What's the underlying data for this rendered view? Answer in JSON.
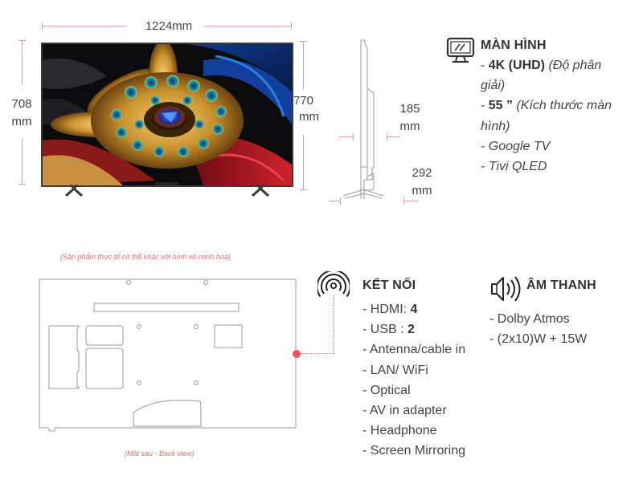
{
  "dimensions": {
    "width": "1224mm",
    "height_panel": {
      "value": "708",
      "unit": "mm"
    },
    "height_total": {
      "value": "770",
      "unit": "mm"
    },
    "depth_panel": {
      "value": "185",
      "unit": "mm"
    },
    "depth_stand": {
      "value": "292",
      "unit": "mm"
    }
  },
  "screen": {
    "icon": "monitor-icon",
    "title": "MÀN HÌNH",
    "lines": [
      {
        "prefix": "- ",
        "bold": "4K (UHD)",
        "italic": " (Độ phân"
      },
      {
        "prefix": "",
        "bold": "",
        "italic": "giải)"
      },
      {
        "prefix": "- ",
        "bold": "55 ”",
        "italic": " (Kích thước màn"
      },
      {
        "prefix": "",
        "bold": "",
        "italic": "hình)"
      },
      {
        "prefix": "",
        "bold": "",
        "italic": "- Google TV"
      },
      {
        "prefix": "",
        "bold": "",
        "italic": "- Tivi QLED"
      }
    ]
  },
  "notes": {
    "disclaimer": "(Sản phẩm thực tế có thể khác với hình vẽ minh hoạ)",
    "back_view": "(Mặt sau - Back view)"
  },
  "connectivity": {
    "icon": "signal-broadcast-icon",
    "title": "KẾT NỐI",
    "items": [
      {
        "text": "- HDMI: ",
        "bold": "4"
      },
      {
        "text": "- USB : ",
        "bold": "2"
      },
      {
        "text": "- Antenna/cable in",
        "bold": ""
      },
      {
        "text": "- LAN/ WiFi",
        "bold": ""
      },
      {
        "text": "- Optical",
        "bold": ""
      },
      {
        "text": "- AV in adapter",
        "bold": ""
      },
      {
        "text": "- Headphone",
        "bold": ""
      },
      {
        "text": "- Screen Mirroring",
        "bold": ""
      }
    ]
  },
  "audio": {
    "icon": "speaker-icon",
    "title": "ÂM THANH",
    "items": [
      "- Dolby Atmos",
      "- (2x10)W + 15W"
    ]
  },
  "colors": {
    "dimension_line": "#d9a0a6",
    "accent_red": "#e85a5a",
    "note_text": "#e07070",
    "outline": "#9a9a9a"
  }
}
